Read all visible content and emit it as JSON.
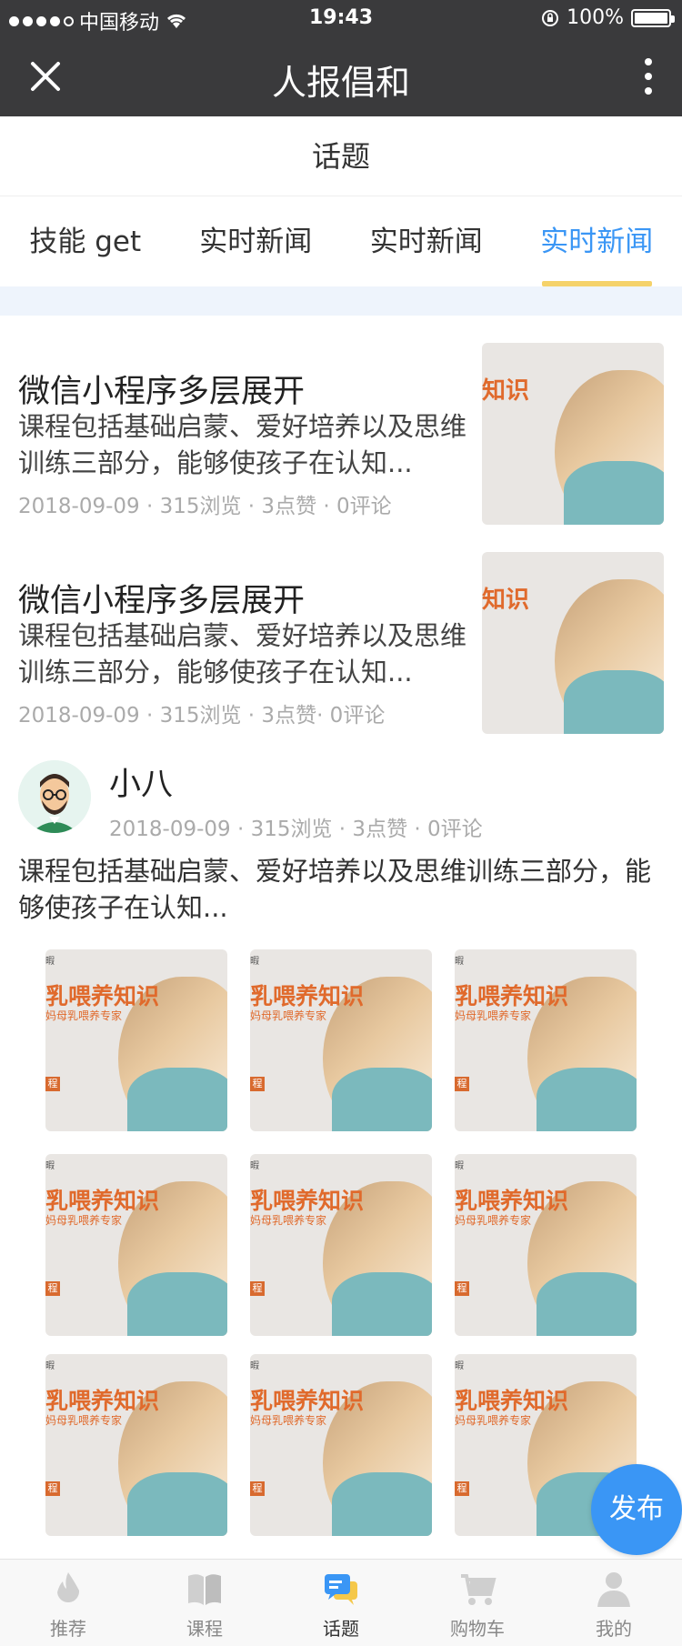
{
  "status_bar": {
    "carrier": "中国移动",
    "time": "19:43",
    "battery": "100%"
  },
  "nav": {
    "title": "人报倡和",
    "close_icon": "close-icon",
    "more_icon": "more-vertical-icon"
  },
  "subheader": {
    "title": "话题"
  },
  "tabs": [
    {
      "label": "技能 get",
      "active": false
    },
    {
      "label": "实时新闻",
      "active": false
    },
    {
      "label": "实时新闻",
      "active": false
    },
    {
      "label": "实时新闻",
      "active": true
    }
  ],
  "articles": [
    {
      "title": "微信小程序多层展开",
      "desc": "课程包括基础启蒙、爱好培养以及思维训练三部分，能够使孩子在认知...",
      "meta": "2018-09-09 · 315浏览 · 3点赞 · 0评论",
      "thumb_text": "知识"
    },
    {
      "title": "微信小程序多层展开",
      "desc": "课程包括基础启蒙、爱好培养以及思维训练三部分，能够使孩子在认知...",
      "meta": "2018-09-09 · 315浏览 · 3点赞· 0评论",
      "thumb_text": "知识"
    }
  ],
  "post": {
    "user": "小八",
    "meta": "2018-09-09 · 315浏览 · 3点赞 · 0评论",
    "body": "课程包括基础启蒙、爱好培养以及思维训练三部分，能够使孩子在认知...",
    "image_text": "乳喂养知识",
    "image_subtext": "妈母乳喂养专家",
    "image_tag": "程",
    "image_corner": "暇"
  },
  "fab": {
    "label": "发布"
  },
  "tabbar": [
    {
      "label": "推荐",
      "icon": "recommend-icon",
      "active": false
    },
    {
      "label": "课程",
      "icon": "book-icon",
      "active": false
    },
    {
      "label": "话题",
      "icon": "topic-chat-icon",
      "active": true
    },
    {
      "label": "购物车",
      "icon": "cart-icon",
      "active": false
    },
    {
      "label": "我的",
      "icon": "user-icon",
      "active": false
    }
  ],
  "colors": {
    "nav_bg": "#3a3a3c",
    "accent": "#3a96f5",
    "tab_indicator": "#f5d26a",
    "image_text": "#e06a2c"
  }
}
